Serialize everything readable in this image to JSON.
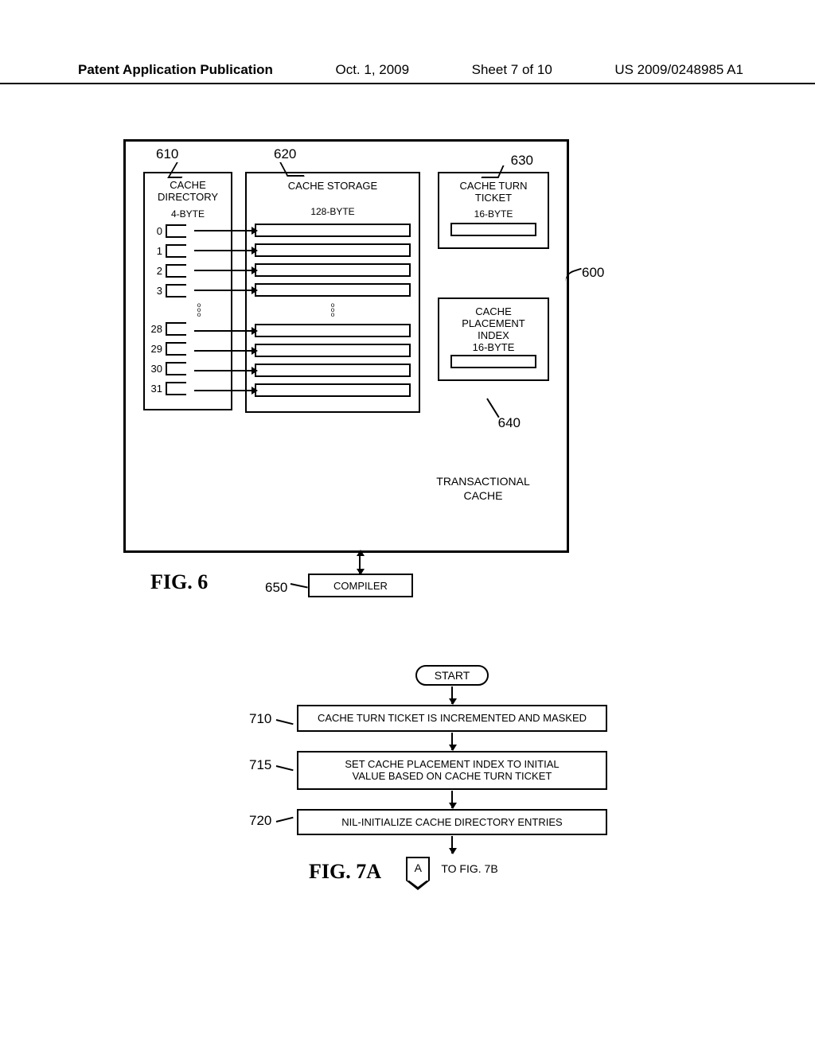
{
  "header": {
    "left": "Patent Application Publication",
    "mid_date": "Oct. 1, 2009",
    "mid_sheet": "Sheet 7 of 10",
    "right": "US 2009/0248985 A1"
  },
  "fig6": {
    "label": "FIG. 6",
    "refs": {
      "r600": "600",
      "r610": "610",
      "r620": "620",
      "r630": "630",
      "r640": "640",
      "r650": "650"
    },
    "directory": {
      "title_l1": "CACHE",
      "title_l2": "DIRECTORY",
      "width_label": "4-BYTE",
      "indices_top": [
        "0",
        "1",
        "2",
        "3"
      ],
      "indices_bottom": [
        "28",
        "29",
        "30",
        "31"
      ]
    },
    "storage": {
      "title": "CACHE STORAGE",
      "width_label": "128-BYTE"
    },
    "turn_ticket": {
      "title_l1": "CACHE TURN",
      "title_l2": "TICKET",
      "width_label": "16-BYTE"
    },
    "placement": {
      "title_l1": "CACHE",
      "title_l2": "PLACEMENT",
      "title_l3": "INDEX",
      "width_label": "16-BYTE"
    },
    "main_label_l1": "TRANSACTIONAL",
    "main_label_l2": "CACHE",
    "compiler_label": "COMPILER"
  },
  "fig7a": {
    "label": "FIG. 7A",
    "start": "START",
    "steps": [
      {
        "ref": "710",
        "text": "CACHE TURN TICKET IS INCREMENTED AND MASKED",
        "ref_pos": "top"
      },
      {
        "ref": "715",
        "text": "SET CACHE PLACEMENT INDEX TO INITIAL\nVALUE BASED ON CACHE TURN TICKET",
        "ref_pos": "top"
      },
      {
        "ref": "720",
        "text": "NIL-INITIALIZE CACHE DIRECTORY ENTRIES",
        "ref_pos": "low"
      }
    ],
    "offpage_letter": "A",
    "to_fig": "TO FIG. 7B"
  }
}
